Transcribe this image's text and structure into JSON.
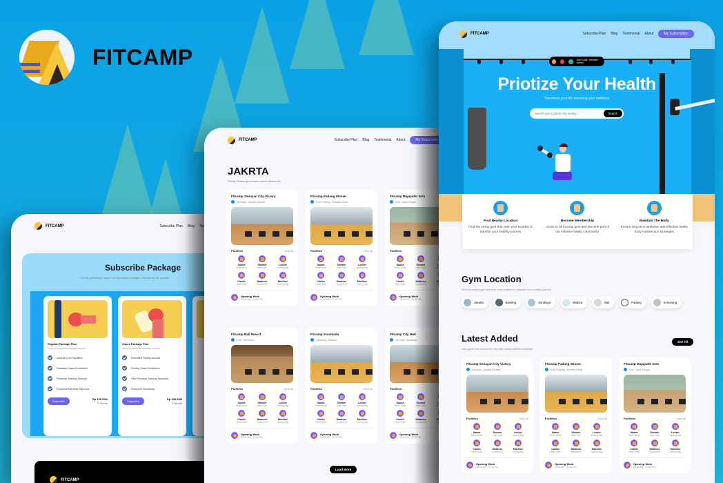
{
  "brand": {
    "name": "FITCAMP"
  },
  "nav": {
    "logo": "FITCAMP",
    "links": [
      "Subscribe Plan",
      "Blog",
      "Testimonial",
      "About"
    ],
    "cta": "My Subscription"
  },
  "subscribe_page": {
    "title": "Subscribe Package",
    "subtitle": "Find the perfect plan, explore our subscription packages. Discover the bes package",
    "plans": [
      {
        "name": "Regular-Package Plan",
        "desc": "Enjoy all subscribe package benefits",
        "features": [
          "Access to All Facilities",
          "Standard Class Enrollment",
          "Personal Training Session",
          "Exclusive Member Discount"
        ],
        "button": "Subscribe",
        "price": "Rp 100.000/",
        "period": "3 Month"
      },
      {
        "name": "Super-Package Plan",
        "desc": "Enjoy all subscribe package benefits",
        "features": [
          "Extended Facility Access",
          "Priority Class Enrollment",
          "Two Personal Training Sessions",
          "Exclusive Workshop"
        ],
        "button": "Subscribe",
        "price": "Rp 200.000/",
        "period": "6 Month"
      }
    ],
    "footer_logo": "FITCAMP"
  },
  "city_page": {
    "title": "JAKRTA",
    "subtitle": "Finding Fitcamp gym location nearby Jakarta City",
    "load_more": "Load More",
    "gyms": [
      {
        "name": "Fitcamp Senayan City Victory",
        "location": "Senayan, Jakarta Selatan"
      },
      {
        "name": "Fitcamp Padang Winner",
        "location": "Kota Padang, Sumatra Barat"
      },
      {
        "name": "Fitcamp Majapahit Solo",
        "location": "Solo, Jawa Tengah"
      },
      {
        "name": "Fitcamp Bali Resort",
        "location": "Kuta, Bali Barat"
      },
      {
        "name": "Fitcamp Suramadu",
        "location": "Sampang, Madura"
      },
      {
        "name": "Fitcamp City Mall",
        "location": "City Mall, Surabaya"
      }
    ]
  },
  "facilities": {
    "label": "Facilities",
    "view_all": "View all",
    "items": [
      {
        "name": "Sauna",
        "desc": "Relax Body"
      },
      {
        "name": "Shower",
        "desc": "After Gym"
      },
      {
        "name": "Locker",
        "desc": "Saving Bag"
      },
      {
        "name": "Cardio",
        "desc": "Heart Rate"
      },
      {
        "name": "Mattress",
        "desc": "Equipment"
      },
      {
        "name": "Machine",
        "desc": "Saving Bag"
      }
    ],
    "opening_label": "Opening Work",
    "opening_hours": "05:00 AM - 11:00 PM"
  },
  "home_page": {
    "badge": "Over 100k+ Member Joined",
    "hero_title": "Priotize Your Health",
    "hero_subtitle": "Transform your life investing your wellness",
    "search_placeholder": "Search gym location, city nearby...",
    "search_button": "Search",
    "features": [
      {
        "title": "Find Nearby Location",
        "desc": "Find the nerby gym that near your location to transfor your healthy journey"
      },
      {
        "title": "Become Membership",
        "desc": "Acces to all fitcamp gym and become part of our exlusive healty community."
      },
      {
        "title": "Maintain The Body",
        "desc": "Ensure long-term wellness with effective healty body maintenace strategies"
      }
    ],
    "gym_location": {
      "title": "Gym Location",
      "subtitle": "Find the nearby gym that near your location to transform your healthy journey",
      "cities": [
        "Jakarta",
        "Banding",
        "Surabaya",
        "Madura",
        "Bali",
        "Padang",
        "Semarang"
      ]
    },
    "latest": {
      "title": "Latest Added",
      "subtitle": "New gyms from around the city with variety facilities available",
      "see_all": "See All",
      "gyms": [
        {
          "name": "Fitcamp Senayan City Victory",
          "location": "Senayan, Jakarta Selatan"
        },
        {
          "name": "Fitcamp Padang Winner",
          "location": "Kota Padang, Sumatra Barat"
        },
        {
          "name": "Fitcamp Majapahit Solo",
          "location": "Solo, Jawa Tengah"
        }
      ]
    }
  }
}
